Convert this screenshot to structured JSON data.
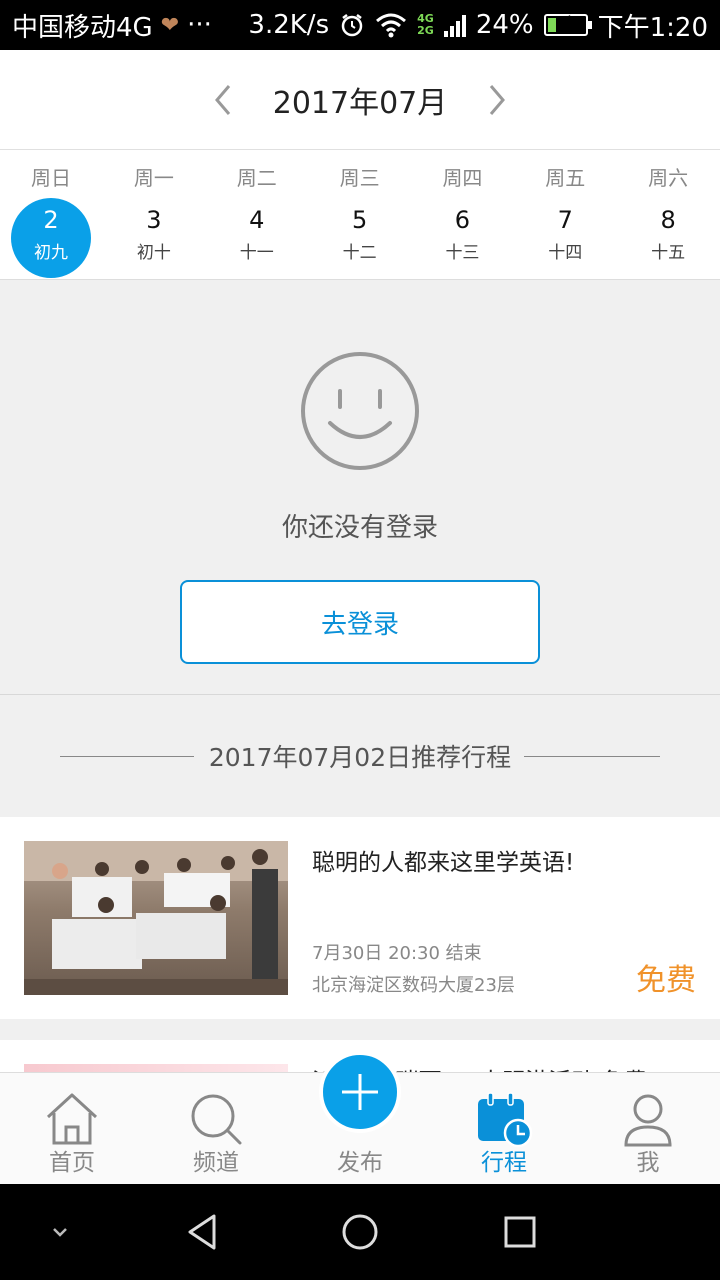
{
  "status_bar": {
    "carrier": "中国移动4G",
    "dots": "···",
    "speed": "3.2K/s",
    "net_top": "4G",
    "net_bottom": "2G",
    "battery": "24%",
    "battery_level": 0.24,
    "time": "下午1:20"
  },
  "calendar": {
    "month_title": "2017年07月",
    "days": [
      {
        "weekday": "周日",
        "date": "2",
        "lunar": "初九",
        "selected": true
      },
      {
        "weekday": "周一",
        "date": "3",
        "lunar": "初十",
        "selected": false
      },
      {
        "weekday": "周二",
        "date": "4",
        "lunar": "十一",
        "selected": false
      },
      {
        "weekday": "周三",
        "date": "5",
        "lunar": "十二",
        "selected": false
      },
      {
        "weekday": "周四",
        "date": "6",
        "lunar": "十三",
        "selected": false
      },
      {
        "weekday": "周五",
        "date": "7",
        "lunar": "十四",
        "selected": false
      },
      {
        "weekday": "周六",
        "date": "8",
        "lunar": "十五",
        "selected": false
      }
    ]
  },
  "empty_state": {
    "message": "你还没有登录",
    "login_button": "去登录"
  },
  "recommend": {
    "title": "2017年07月02日推荐行程",
    "items": [
      {
        "title": "聪明的人都来这里学英语!",
        "time": "7月30日 20:30 结束",
        "location": "北京海淀区数码大厦23层",
        "price": "免费"
      },
      {
        "title": "派对 一 瑞丽 一 大明港活动 免费 ..."
      }
    ]
  },
  "tabs": [
    {
      "label": "首页",
      "icon": "home-icon"
    },
    {
      "label": "频道",
      "icon": "search-icon"
    },
    {
      "label": "发布",
      "icon": "plus-icon"
    },
    {
      "label": "行程",
      "icon": "calendar-icon",
      "active": true
    },
    {
      "label": "我",
      "icon": "person-icon"
    }
  ],
  "colors": {
    "accent": "#0aa0e8",
    "price": "#f0922a"
  }
}
